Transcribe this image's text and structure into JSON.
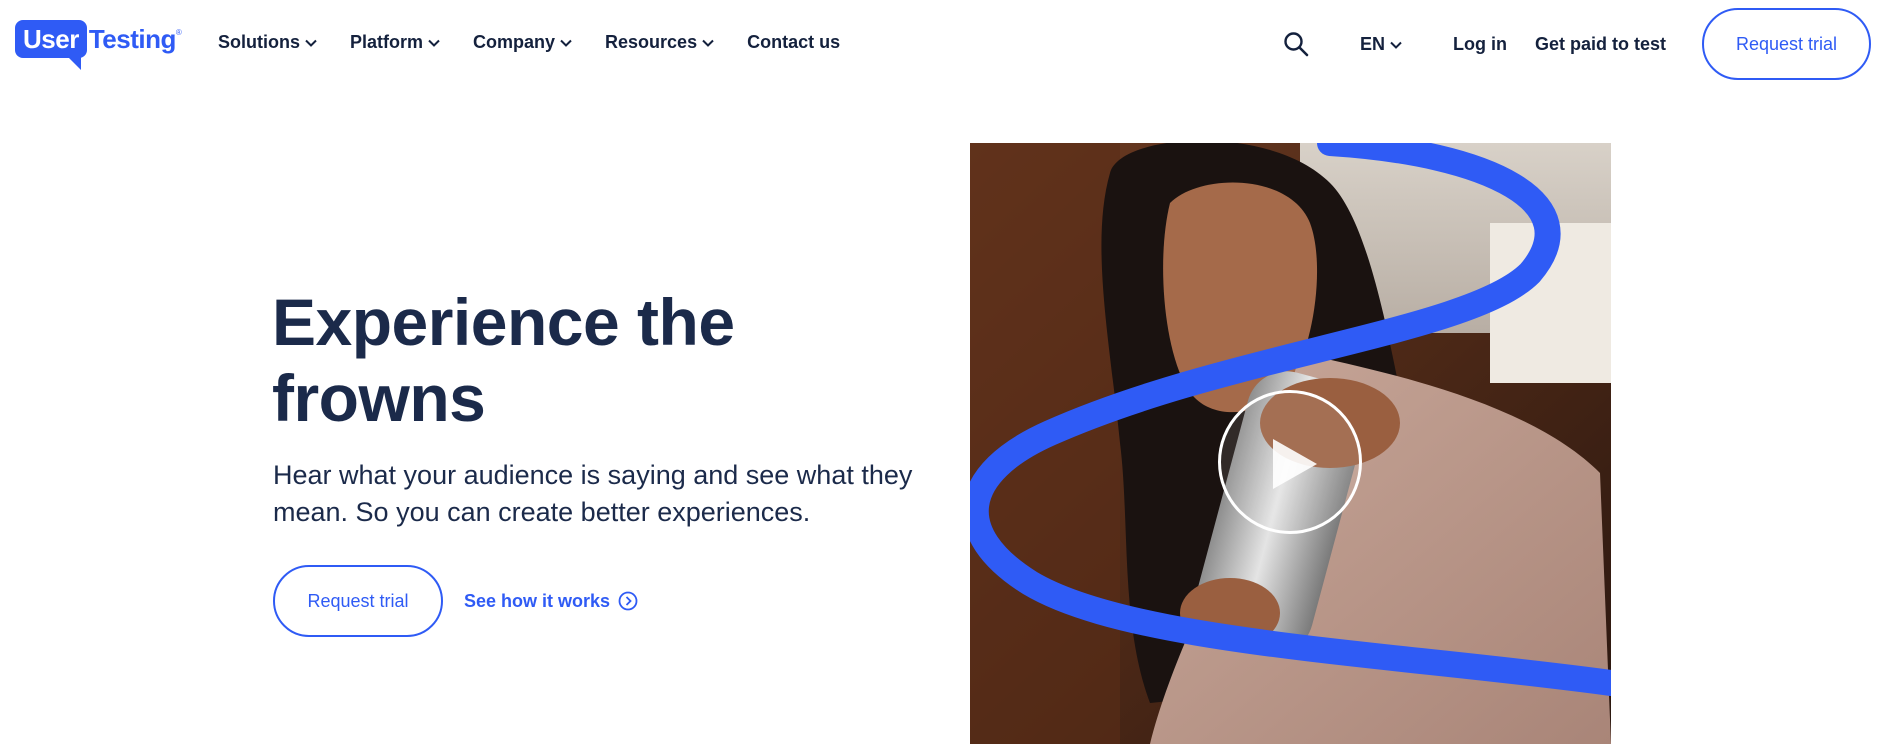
{
  "brand": {
    "logo_user": "User",
    "logo_testing": "Testing",
    "logo_tm": "®",
    "accent": "#2f5bf5",
    "text_dark": "#1b2a4a"
  },
  "nav": {
    "items": [
      {
        "label": "Solutions",
        "has_dropdown": true
      },
      {
        "label": "Platform",
        "has_dropdown": true
      },
      {
        "label": "Company",
        "has_dropdown": true
      },
      {
        "label": "Resources",
        "has_dropdown": true
      },
      {
        "label": "Contact us",
        "has_dropdown": false
      }
    ],
    "language": "EN",
    "login": "Log in",
    "get_paid": "Get paid to test",
    "request_trial": "Request trial",
    "search_icon": "search-icon"
  },
  "hero": {
    "title_line1": "Experience the",
    "title_line2": "frowns",
    "subtitle": "Hear what your audience is saying and see what they mean. So you can create better experiences.",
    "cta_primary": "Request trial",
    "cta_secondary": "See how it works",
    "video_icon": "play-icon"
  }
}
